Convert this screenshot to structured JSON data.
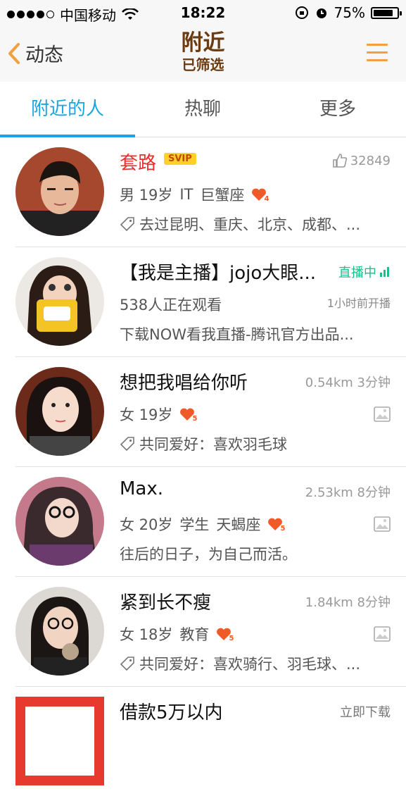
{
  "status": {
    "carrier": "中国移动",
    "time": "18:22",
    "battery": "75%"
  },
  "nav": {
    "back_label": "动态",
    "title": "附近",
    "subtitle": "已筛选"
  },
  "tabs": [
    {
      "label": "附近的人",
      "active": true
    },
    {
      "label": "热聊",
      "active": false
    },
    {
      "label": "更多",
      "active": false
    }
  ],
  "people": [
    {
      "name": "套路",
      "vip": "SVIP",
      "likes": "32849",
      "info": [
        "男 19岁",
        "IT",
        "巨蟹座"
      ],
      "level": "4",
      "tag_text": "去过昆明、重庆、北京、成都、..."
    },
    {
      "name": "【我是主播】jojo大眼...",
      "live_label": "直播中",
      "viewers": "538人正在观看",
      "start_time": "1小时前开播",
      "desc": "下载NOW看我直播-腾讯官方出品..."
    },
    {
      "name": "想把我唱给你听",
      "distance": "0.54km 3分钟",
      "info": [
        "女 19岁"
      ],
      "level": "5",
      "tag_text": "共同爱好：喜欢羽毛球"
    },
    {
      "name": "Max.",
      "distance": "2.53km 8分钟",
      "info": [
        "女 20岁",
        "学生",
        "天蝎座"
      ],
      "level": "5",
      "sign": "往后的日子，为自己而活。"
    },
    {
      "name": "紧到长不瘦",
      "distance": "1.84km 8分钟",
      "info": [
        "女 18岁",
        "教育"
      ],
      "level": "5",
      "tag_text": "共同爱好：喜欢骑行、羽毛球、..."
    },
    {
      "name": "借款5万以内",
      "ad_action": "立即下载"
    }
  ]
}
